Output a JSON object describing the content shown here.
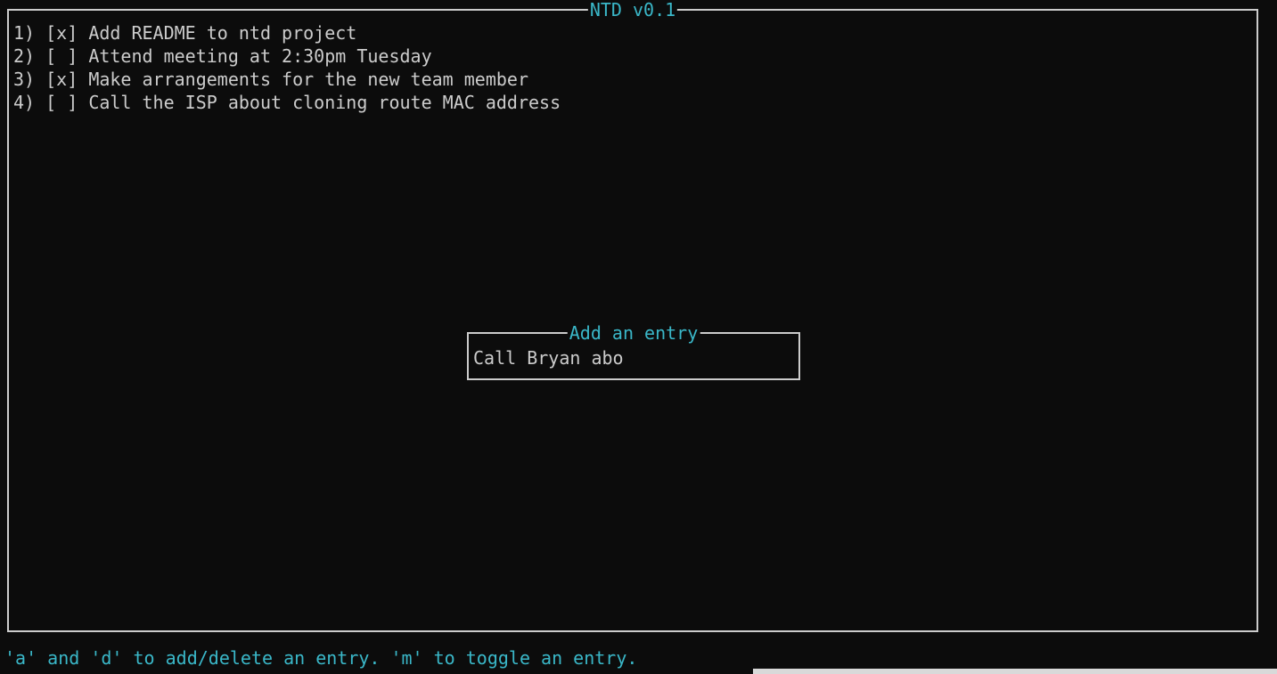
{
  "app": {
    "title": "NTD v0.1"
  },
  "todos": [
    {
      "number": "1)",
      "checked": true,
      "text": "Add README to ntd project"
    },
    {
      "number": "2)",
      "checked": false,
      "text": "Attend meeting at 2:30pm Tuesday"
    },
    {
      "number": "3)",
      "checked": true,
      "text": "Make arrangements for the new team member"
    },
    {
      "number": "4)",
      "checked": false,
      "text": "Call the ISP about cloning route MAC address"
    }
  ],
  "dialog": {
    "title": "Add an entry",
    "input_value": "Call Bryan abo"
  },
  "status": {
    "help_text": "'a' and 'd' to add/delete an entry. 'm' to toggle an entry."
  },
  "colors": {
    "background": "#0c0c0c",
    "text": "#cccccc",
    "accent": "#3ab7c8"
  }
}
